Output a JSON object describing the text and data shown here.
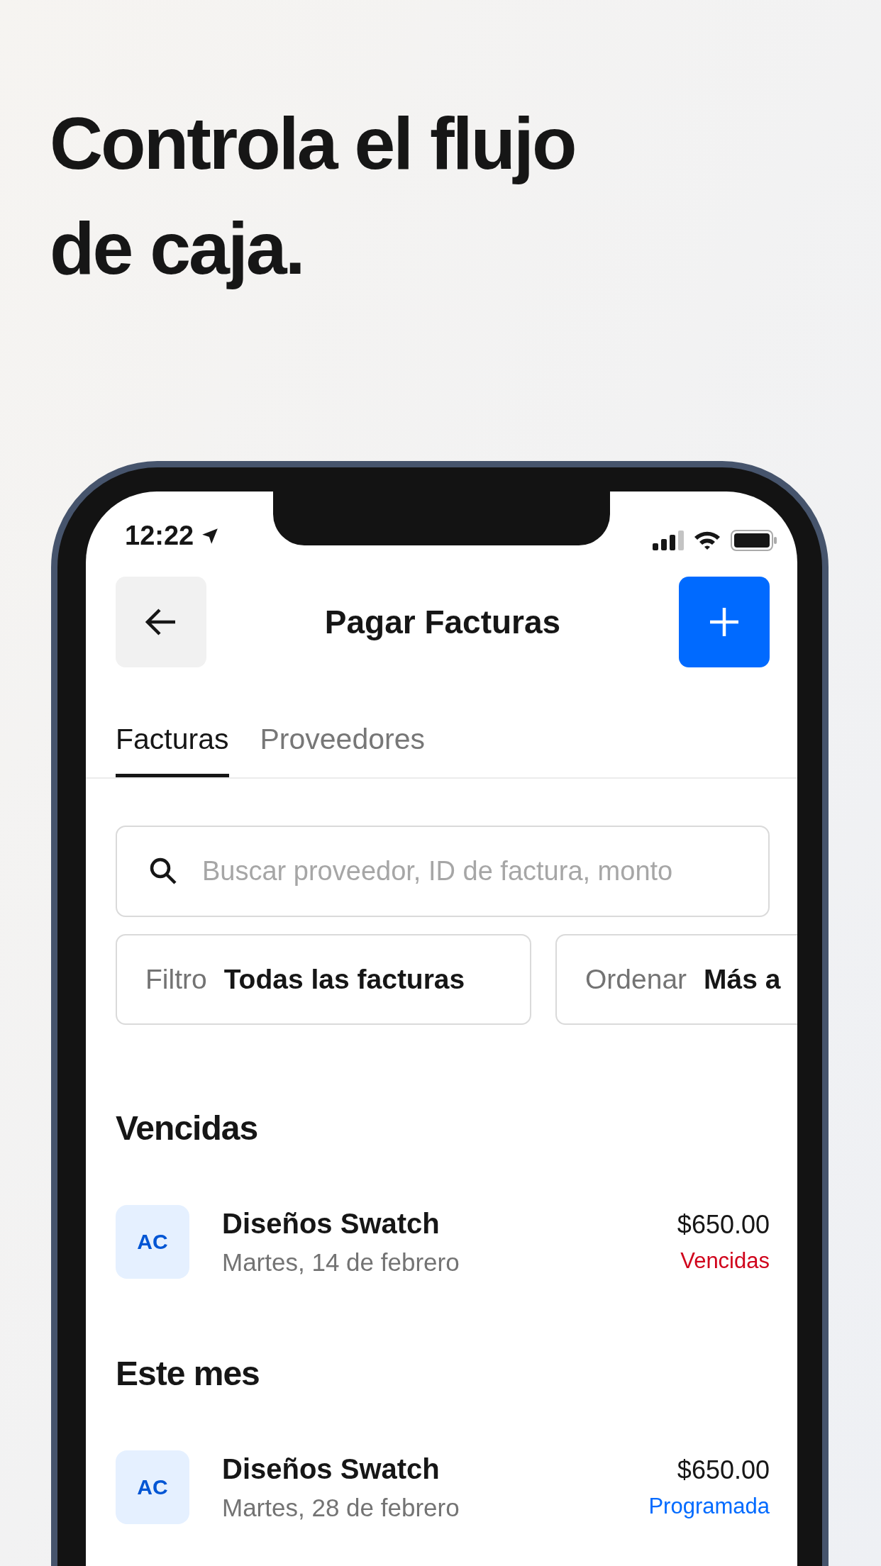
{
  "headline": "Controla el flujo de caja.",
  "status_bar": {
    "time": "12:22"
  },
  "header": {
    "title": "Pagar Facturas"
  },
  "tabs": [
    {
      "label": "Facturas",
      "selected": true
    },
    {
      "label": "Proveedores",
      "selected": false
    }
  ],
  "search": {
    "placeholder": "Buscar proveedor, ID de factura, monto"
  },
  "chips": [
    {
      "label": "Filtro",
      "value": "Todas las facturas"
    },
    {
      "label": "Ordenar",
      "value": "Más a"
    }
  ],
  "sections": [
    {
      "title": "Vencidas",
      "items": [
        {
          "initials": "AC",
          "name": "Diseños Swatch",
          "date": "Martes, 14 de febrero",
          "amount": "$650.00",
          "status": "Vencidas",
          "color": "#d0021b"
        }
      ]
    },
    {
      "title": "Este mes",
      "items": [
        {
          "initials": "AC",
          "name": "Diseños Swatch",
          "date": "Martes, 28 de febrero",
          "amount": "$650.00",
          "status": "Programada",
          "color": "#006aff"
        }
      ]
    }
  ]
}
